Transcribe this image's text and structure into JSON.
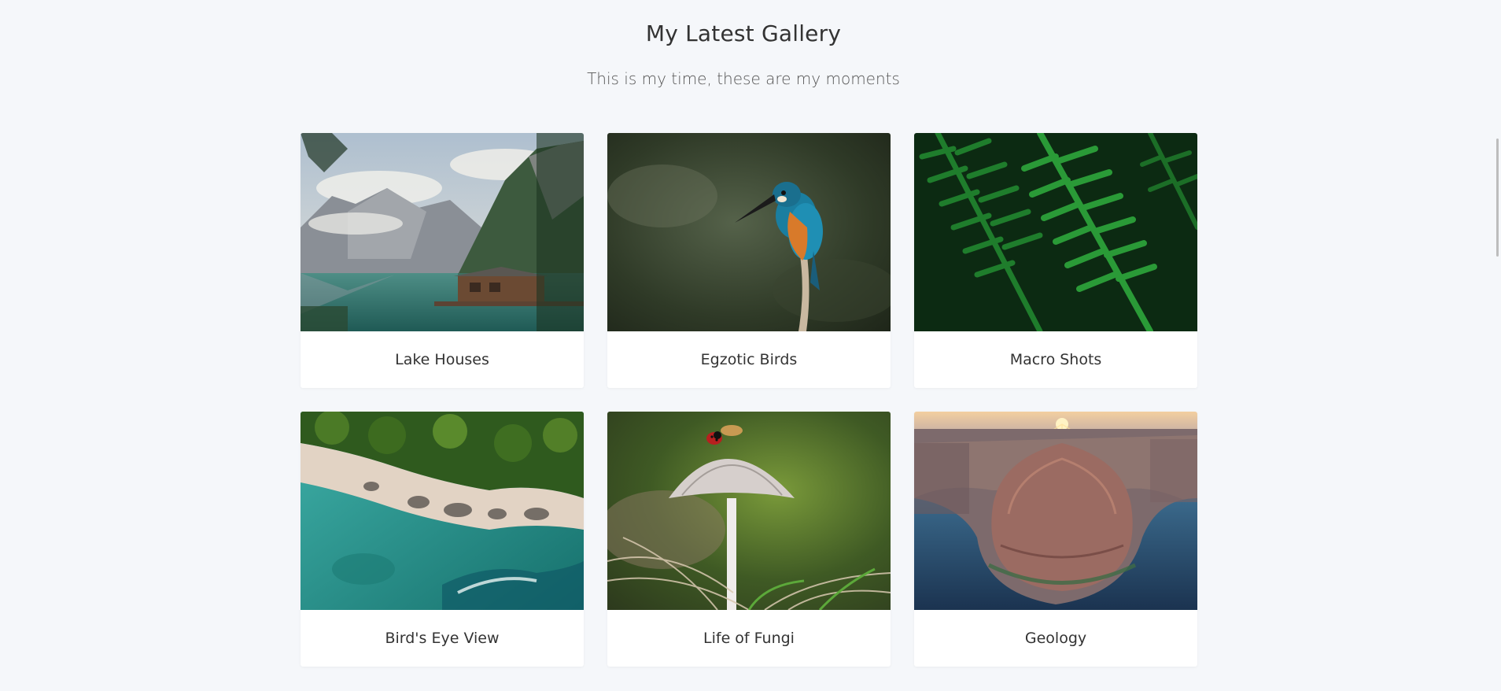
{
  "header": {
    "title": "My Latest Gallery",
    "subtitle": "This is my time, these are my moments"
  },
  "gallery": {
    "items": [
      {
        "label": "Lake Houses",
        "image": "lake-house-mountains"
      },
      {
        "label": "Egzotic Birds",
        "image": "kingfisher-bird"
      },
      {
        "label": "Macro Shots",
        "image": "fern-leaves"
      },
      {
        "label": "Bird's Eye View",
        "image": "aerial-coastline"
      },
      {
        "label": "Life of Fungi",
        "image": "mushroom-ladybug"
      },
      {
        "label": "Geology",
        "image": "canyon-river-bend"
      }
    ]
  },
  "colors": {
    "background": "#f5f7fa",
    "card": "#ffffff",
    "text": "#333333"
  }
}
